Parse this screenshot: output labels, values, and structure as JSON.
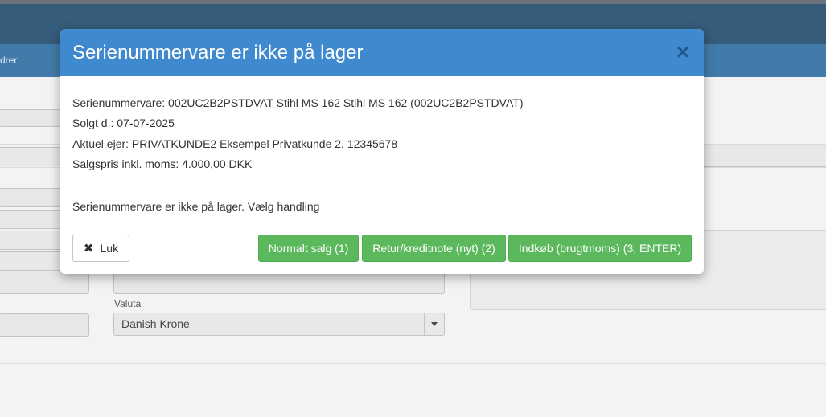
{
  "app": {
    "nav_partial_label": "drer",
    "valuta_label": "Valuta",
    "valuta_value": "Danish Krone"
  },
  "modal": {
    "title": "Serienummervare er ikke på lager",
    "close_glyph": "×",
    "lines": [
      "Serienummervare: 002UC2B2PSTDVAT Stihl MS 162 Stihl MS 162 (002UC2B2PSTDVAT)",
      "Solgt d.: 07-07-2025",
      "Aktuel ejer: PRIVATKUNDE2 Eksempel Privatkunde 2, 12345678",
      "Salgspris inkl. moms: 4.000,00 DKK"
    ],
    "prompt": "Serienummervare er ikke på lager. Vælg handling",
    "buttons": {
      "close_label": "Luk",
      "close_icon": "✖",
      "normal_sale": "Normalt salg (1)",
      "return_credit": "Retur/kreditnote (nyt) (2)",
      "purchase": "Indkøb (brugtmoms) (3, ENTER)"
    },
    "colors": {
      "header": "#3f89cf",
      "success": "#5cb85c"
    }
  }
}
